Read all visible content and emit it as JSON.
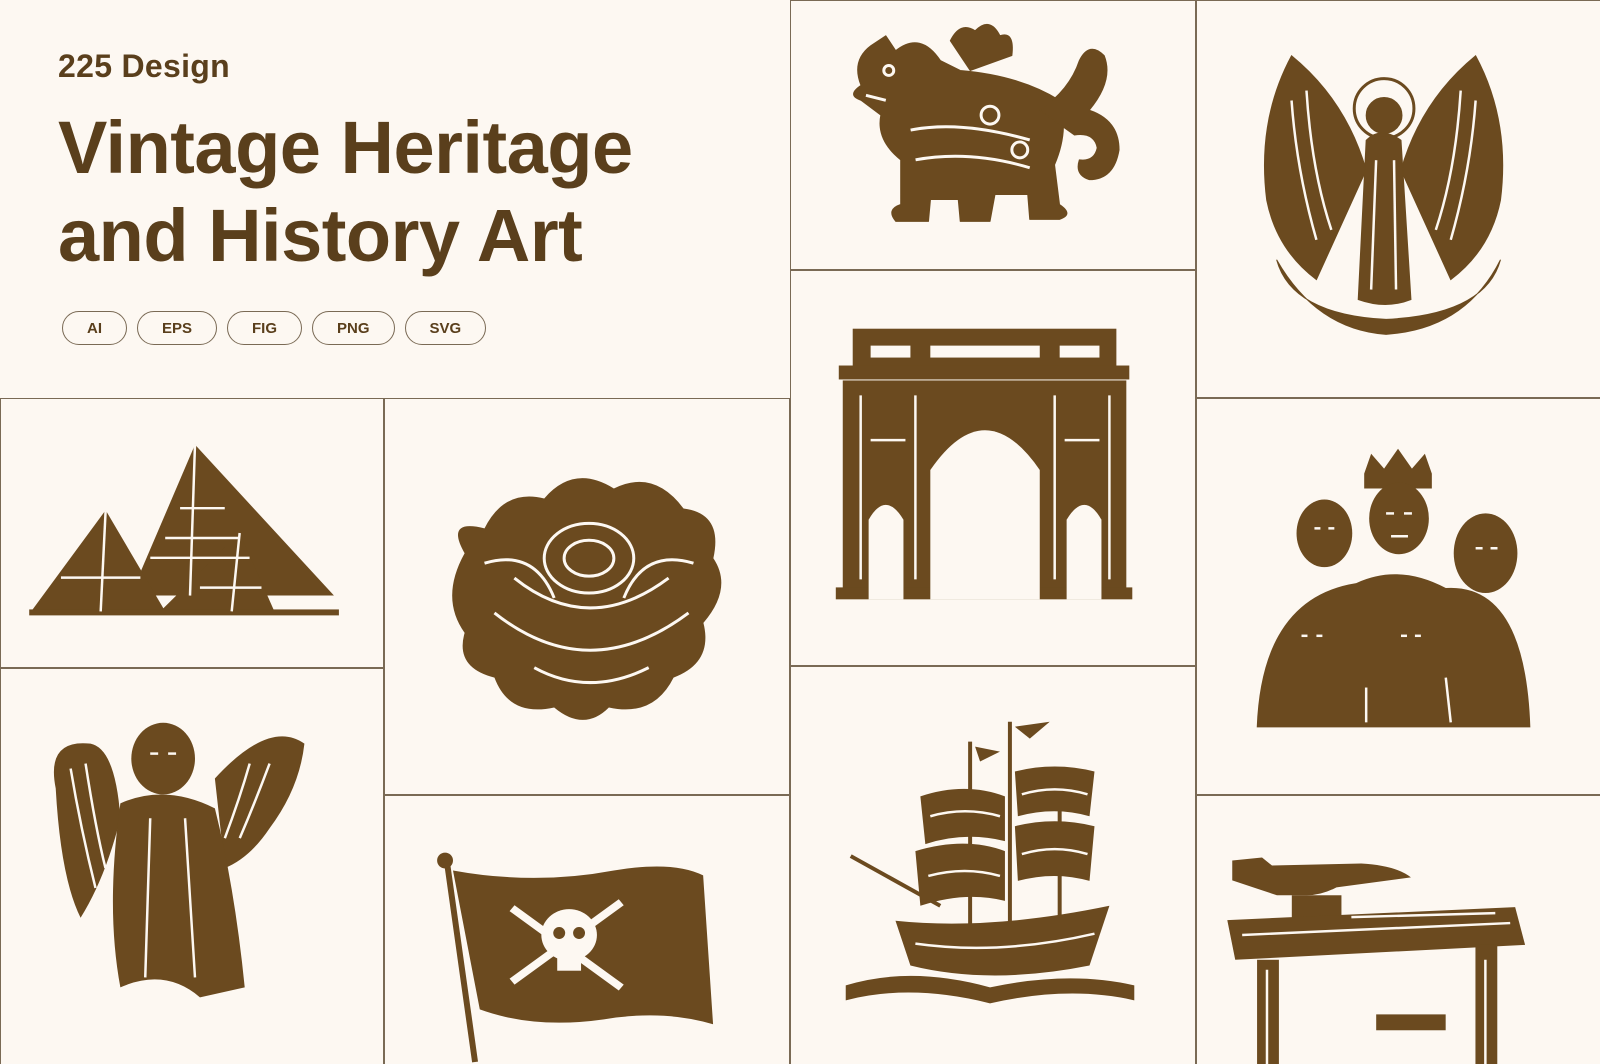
{
  "header": {
    "count_label": "225 Design",
    "title_line1": "Vintage Heritage",
    "title_line2": "and History Art"
  },
  "formats": [
    "AI",
    "EPS",
    "FIG",
    "PNG",
    "SVG"
  ],
  "colors": {
    "background": "#fdf8f2",
    "ink": "#6b4a1f",
    "text": "#5a3f1c",
    "border": "#7a6a55"
  },
  "illustrations": [
    {
      "id": "lion",
      "icon": "guardian-lion-icon"
    },
    {
      "id": "angel-halo",
      "icon": "winged-angel-halo-icon"
    },
    {
      "id": "pyramids",
      "icon": "pyramids-icon"
    },
    {
      "id": "rose",
      "icon": "rose-flower-icon"
    },
    {
      "id": "arch",
      "icon": "triumphal-arch-icon"
    },
    {
      "id": "family",
      "icon": "royal-family-portrait-icon"
    },
    {
      "id": "cherub",
      "icon": "praying-angel-icon"
    },
    {
      "id": "flag",
      "icon": "pirate-flag-icon"
    },
    {
      "id": "ship",
      "icon": "sailing-ship-icon"
    },
    {
      "id": "anvil",
      "icon": "anvil-workbench-icon"
    }
  ]
}
